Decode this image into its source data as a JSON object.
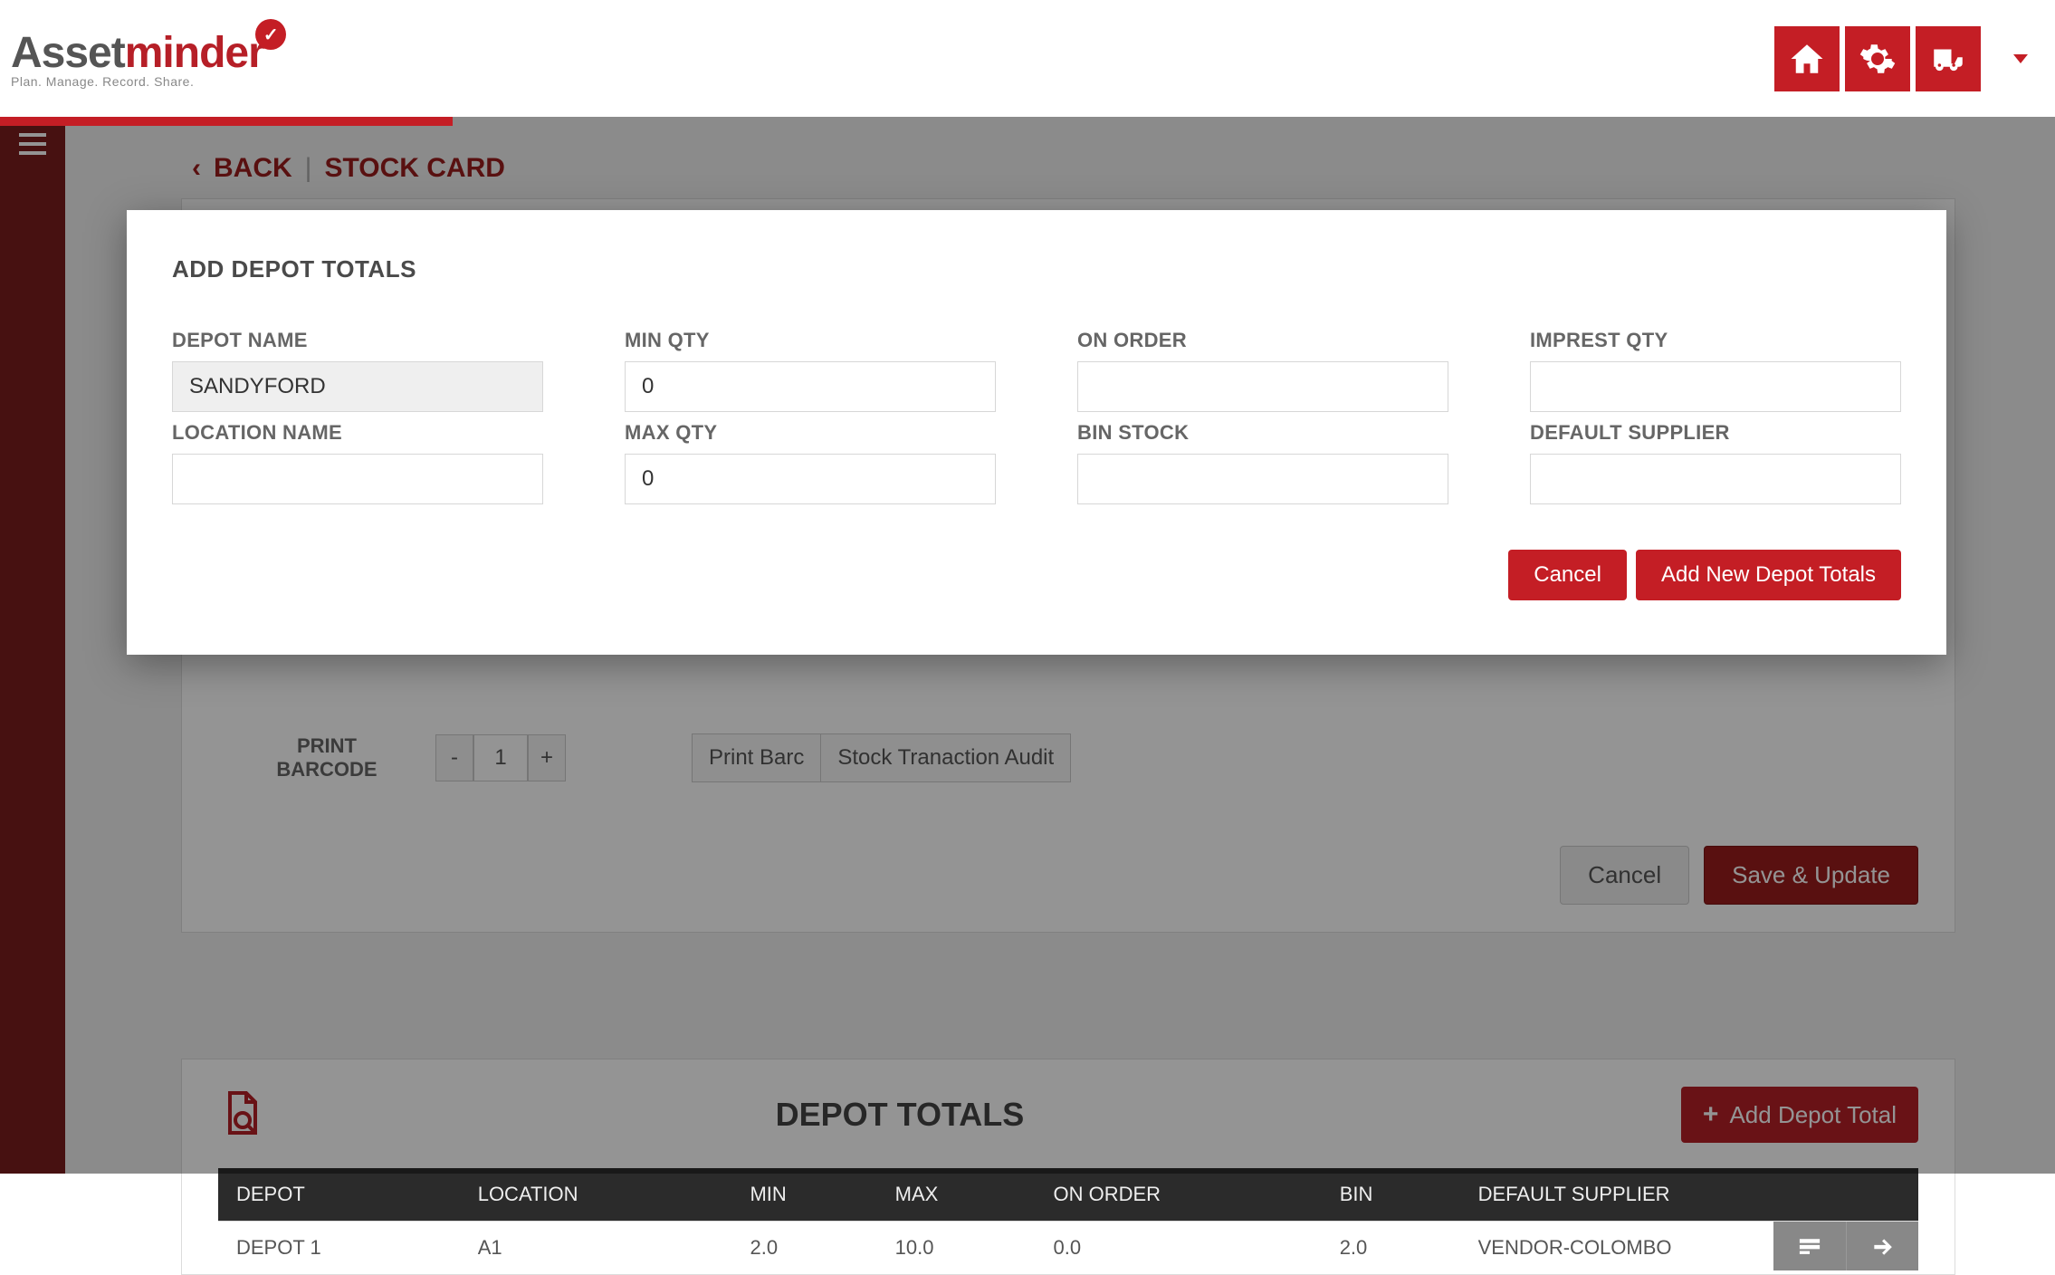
{
  "brand": {
    "part1": "Asset",
    "part2": "minder",
    "tag": "Plan. Manage. Record. Share."
  },
  "crumb": {
    "back": "BACK",
    "title": "STOCK CARD"
  },
  "barcode": {
    "label_l1": "PRINT",
    "label_l2": "BARCODE",
    "qty": "1",
    "print_btn": "Print Barc",
    "audit_btn": "Stock Tranaction Audit"
  },
  "actions": {
    "cancel": "Cancel",
    "save": "Save & Update"
  },
  "depot": {
    "title": "DEPOT TOTALS",
    "add_btn": "Add Depot Total",
    "cols": {
      "depot": "DEPOT",
      "location": "LOCATION",
      "min": "MIN",
      "max": "MAX",
      "on_order": "ON ORDER",
      "bin": "BIN",
      "supplier": "DEFAULT SUPPLIER"
    },
    "rows": [
      {
        "depot": "DEPOT 1",
        "location": "A1",
        "min": "2.0",
        "max": "10.0",
        "on_order": "0.0",
        "bin": "2.0",
        "supplier": "VENDOR-COLOMBO"
      }
    ]
  },
  "modal": {
    "title": "ADD DEPOT TOTALS",
    "labels": {
      "depot_name": "DEPOT NAME",
      "location_name": "LOCATION NAME",
      "min_qty": "MIN QTY",
      "max_qty": "MAX QTY",
      "on_order": "ON ORDER",
      "bin_stock": "BIN STOCK",
      "imprest_qty": "IMPREST QTY",
      "default_supplier": "DEFAULT SUPPLIER"
    },
    "values": {
      "depot_name": "SANDYFORD",
      "location_name": "",
      "min_qty": "0",
      "max_qty": "0",
      "on_order": "",
      "bin_stock": "",
      "imprest_qty": "",
      "default_supplier": ""
    },
    "buttons": {
      "cancel": "Cancel",
      "add": "Add New Depot Totals"
    }
  }
}
